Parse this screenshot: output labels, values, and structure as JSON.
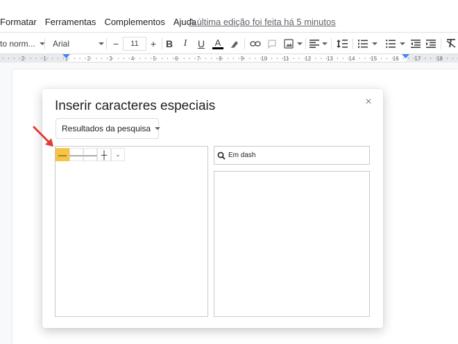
{
  "menu": {
    "items": [
      "Formatar",
      "Ferramentas",
      "Complementos",
      "Ajuda"
    ],
    "last_edit": "A última edição foi feita há 5 minutos"
  },
  "toolbar": {
    "style_label": "to norm...",
    "font_label": "Arial",
    "minus": "−",
    "font_size": "11",
    "plus": "+",
    "bold": "B",
    "italic": "I",
    "underline": "U",
    "text_color": "A"
  },
  "ruler": {
    "ticks": [
      "2",
      "1",
      "1",
      "2",
      "3",
      "4",
      "5",
      "6",
      "7",
      "8",
      "9",
      "10",
      "11",
      "12",
      "13",
      "14",
      "15",
      "16",
      "17",
      "18"
    ]
  },
  "dialog": {
    "title": "Inserir caracteres especiais",
    "close": "×",
    "dropdown_label": "Resultados da pesquisa",
    "results": [
      "—",
      "―",
      "—",
      "┼",
      "-"
    ],
    "search_value": "Em dash",
    "search_placeholder": ""
  },
  "colors": {
    "selected_cell": "#f6c343",
    "arrow": "#e53935",
    "text_color_bar": "#000000"
  }
}
